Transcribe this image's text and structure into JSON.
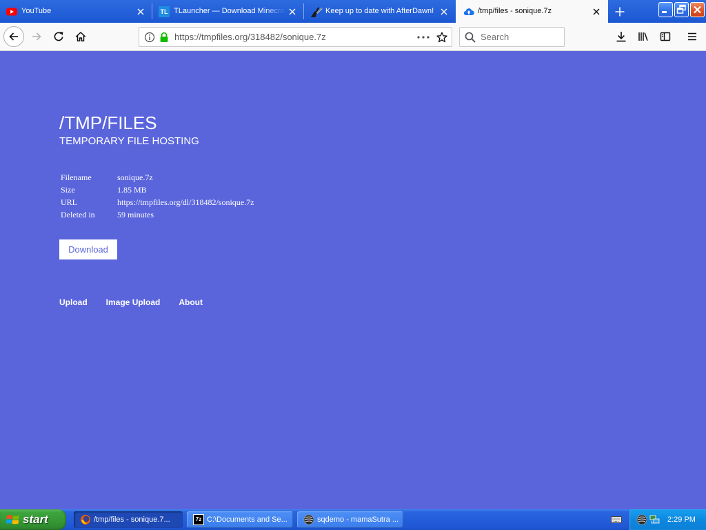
{
  "browser": {
    "tabs": [
      {
        "title": "YouTube",
        "icon": "youtube-icon",
        "active": false
      },
      {
        "title": "TLauncher — Download Minecraft",
        "icon": "tlauncher-icon",
        "icon_text": "TL",
        "active": false
      },
      {
        "title": "Keep up to date with AfterDawn!",
        "icon": "afterdawn-icon",
        "active": false
      },
      {
        "title": "/tmp/files - sonique.7z",
        "icon": "cloud-upload-icon",
        "active": true
      }
    ],
    "new_tab_icon": "plus-icon",
    "url": "https://tmpfiles.org/318482/sonique.7z",
    "search_placeholder": "Search",
    "toolbar_icons": [
      "back-arrow-icon",
      "forward-arrow-icon",
      "reload-icon",
      "home-icon",
      "info-icon",
      "lock-icon",
      "page-actions-icon",
      "bookmark-star-icon",
      "search-icon",
      "download-icon",
      "library-icon",
      "sidebar-icon",
      "menu-icon"
    ]
  },
  "page": {
    "heading": "/TMP/FILES",
    "subheading": "TEMPORARY FILE HOSTING",
    "file_info": [
      {
        "label": "Filename",
        "value": "sonique.7z"
      },
      {
        "label": "Size",
        "value": "1.85 MB"
      },
      {
        "label": "URL",
        "value": "https://tmpfiles.org/dl/318482/sonique.7z"
      },
      {
        "label": "Deleted in",
        "value": "59 minutes"
      }
    ],
    "download_label": "Download",
    "nav_links": [
      "Upload",
      "Image Upload",
      "About"
    ]
  },
  "taskbar": {
    "start_label": "start",
    "tasks": [
      {
        "label": "/tmp/files - sonique.7...",
        "icon": "firefox-icon",
        "active": true
      },
      {
        "label": "C:\\Documents and Se...",
        "icon": "7zip-icon",
        "icon_text": "7z",
        "active": false
      },
      {
        "label": "sqdemo - mamaSutra ...",
        "icon": "sqdemo-icon",
        "active": false
      }
    ],
    "tray_icons": [
      "keyboard-icon",
      "sqdemo-tray-icon",
      "network-icon"
    ],
    "clock": "2:29 PM"
  },
  "colors": {
    "page_background": "#5a65dc",
    "lock_green": "#12bc00",
    "taskbar_blue": "#245edb",
    "start_green": "#379a37",
    "close_button_red": "#df5528"
  }
}
